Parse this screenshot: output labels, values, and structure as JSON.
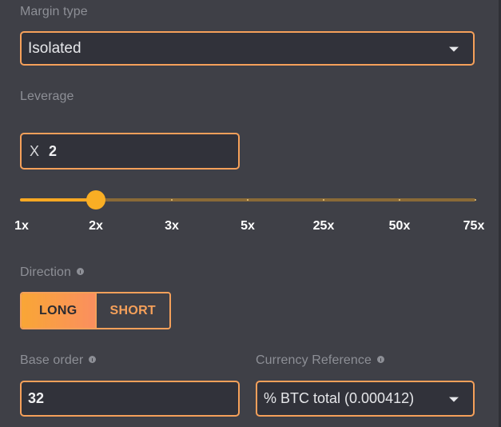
{
  "margin_type": {
    "label": "Margin type",
    "selected": "Isolated"
  },
  "leverage": {
    "label": "Leverage",
    "prefix": "X",
    "value": "2",
    "slider": {
      "ticks": [
        "1x",
        "2x",
        "3x",
        "5x",
        "25x",
        "50x",
        "75x"
      ],
      "selected_index": 1
    }
  },
  "direction": {
    "label": "Direction",
    "options": [
      "LONG",
      "SHORT"
    ],
    "selected": "LONG"
  },
  "base_order": {
    "label": "Base order",
    "value": "32"
  },
  "currency_reference": {
    "label": "Currency Reference",
    "selected": "% BTC total (0.000412)"
  },
  "colors": {
    "accent": "#f5a05a",
    "slider_fill": "#f7a823",
    "background": "#3f4047",
    "field_bg": "#31323a"
  },
  "icons": {
    "dropdown": "chevron-down-icon",
    "info": "info-icon"
  }
}
